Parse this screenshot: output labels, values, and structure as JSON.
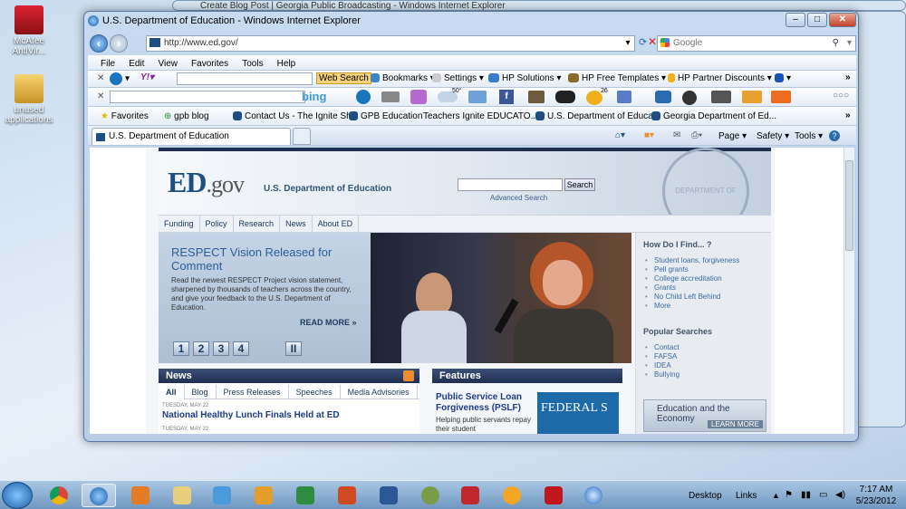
{
  "desktop": {
    "icons": [
      {
        "label": "McAfee AntiVir...",
        "icon": "mcafee-icon"
      },
      {
        "label": "unused applications",
        "icon": "folder-icon"
      }
    ]
  },
  "background_window": {
    "title": "Create Blog Post | Georgia Public Broadcasting - Windows Internet Explorer"
  },
  "browser": {
    "title": "U.S. Department of Education - Windows Internet Explorer",
    "controls": {
      "minimize": "–",
      "maximize": "□",
      "close": "✕"
    },
    "address": "http://www.ed.gov/",
    "search_placeholder": "Google",
    "menu": [
      "File",
      "Edit",
      "View",
      "Favorites",
      "Tools",
      "Help"
    ],
    "toolbar1": {
      "web_search": "Web Search",
      "bookmarks": "Bookmarks",
      "settings": "Settings",
      "hp_solutions": "HP Solutions",
      "hp_templates": "HP Free Templates",
      "hp_partner": "HP Partner Discounts"
    },
    "toolbar2": {
      "bing": "bing",
      "weather": "50°",
      "count": "26"
    },
    "favorites": {
      "label": "Favorites",
      "items": [
        "gpb blog",
        "Contact Us - The Ignite Sh...",
        "GPB Education",
        "Teachers Ignite EDUCATO...",
        "U.S. Department of Educa...",
        "Georgia Department of Ed..."
      ]
    },
    "tab": "U.S. Department of Education",
    "command_bar": {
      "page": "Page",
      "safety": "Safety",
      "tools": "Tools"
    }
  },
  "site": {
    "logo": "ED",
    "logo_suffix": ".gov",
    "dept_name": "U.S. Department of Education",
    "search_button": "Search",
    "advanced_search": "Advanced Search",
    "seal_text": "DEPARTMENT OF EDUCATION",
    "nav": [
      "Funding",
      "Policy",
      "Research",
      "News",
      "About ED"
    ],
    "hero": {
      "title": "RESPECT Vision Released for Comment",
      "body": "Read the newest RESPECT Project vision statement, sharpened by thousands of teachers across the country, and give your feedback to the U.S. Department of Education.",
      "more": "READ MORE »",
      "pages": [
        "1",
        "2",
        "3",
        "4"
      ],
      "pause": "II"
    },
    "sidebar": {
      "find_title": "How Do I Find... ?",
      "find_links": [
        "Student loans, forgiveness",
        "Pell grants",
        "College accreditation",
        "Grants",
        "No Child Left Behind",
        "More"
      ],
      "popular_title": "Popular Searches",
      "popular_links": [
        "Contact",
        "FAFSA",
        "IDEA",
        "Bullying"
      ],
      "promo_title": "Education and the Economy",
      "promo_more": "LEARN MORE"
    },
    "news": {
      "title": "News",
      "tabs": [
        "All",
        "Blog",
        "Press Releases",
        "Speeches",
        "Media Advisories"
      ],
      "items": [
        {
          "date": "TUESDAY, MAY 22",
          "headline": "National Healthy Lunch Finals Held at ED"
        },
        {
          "date": "TUESDAY, MAY 22",
          "headline": ""
        }
      ]
    },
    "features": {
      "title": "Features",
      "headline": "Public Service Loan Forgiveness (PSLF)",
      "body": "Helping public servants repay their student",
      "banner": "FEDERAL S"
    }
  },
  "taskbar": {
    "apps": [
      "start-orb",
      "chrome-icon",
      "ie-icon",
      "media-icon",
      "explorer-icon",
      "dropbox-icon",
      "outlook-icon",
      "excel-icon",
      "powerpoint-icon",
      "word-icon",
      "network-icon",
      "mcafee-icon",
      "flower-icon",
      "acrobat-icon",
      "itunes-icon"
    ],
    "desktop_label": "Desktop",
    "links_label": "Links",
    "time": "7:17 AM",
    "date": "5/23/2012"
  }
}
